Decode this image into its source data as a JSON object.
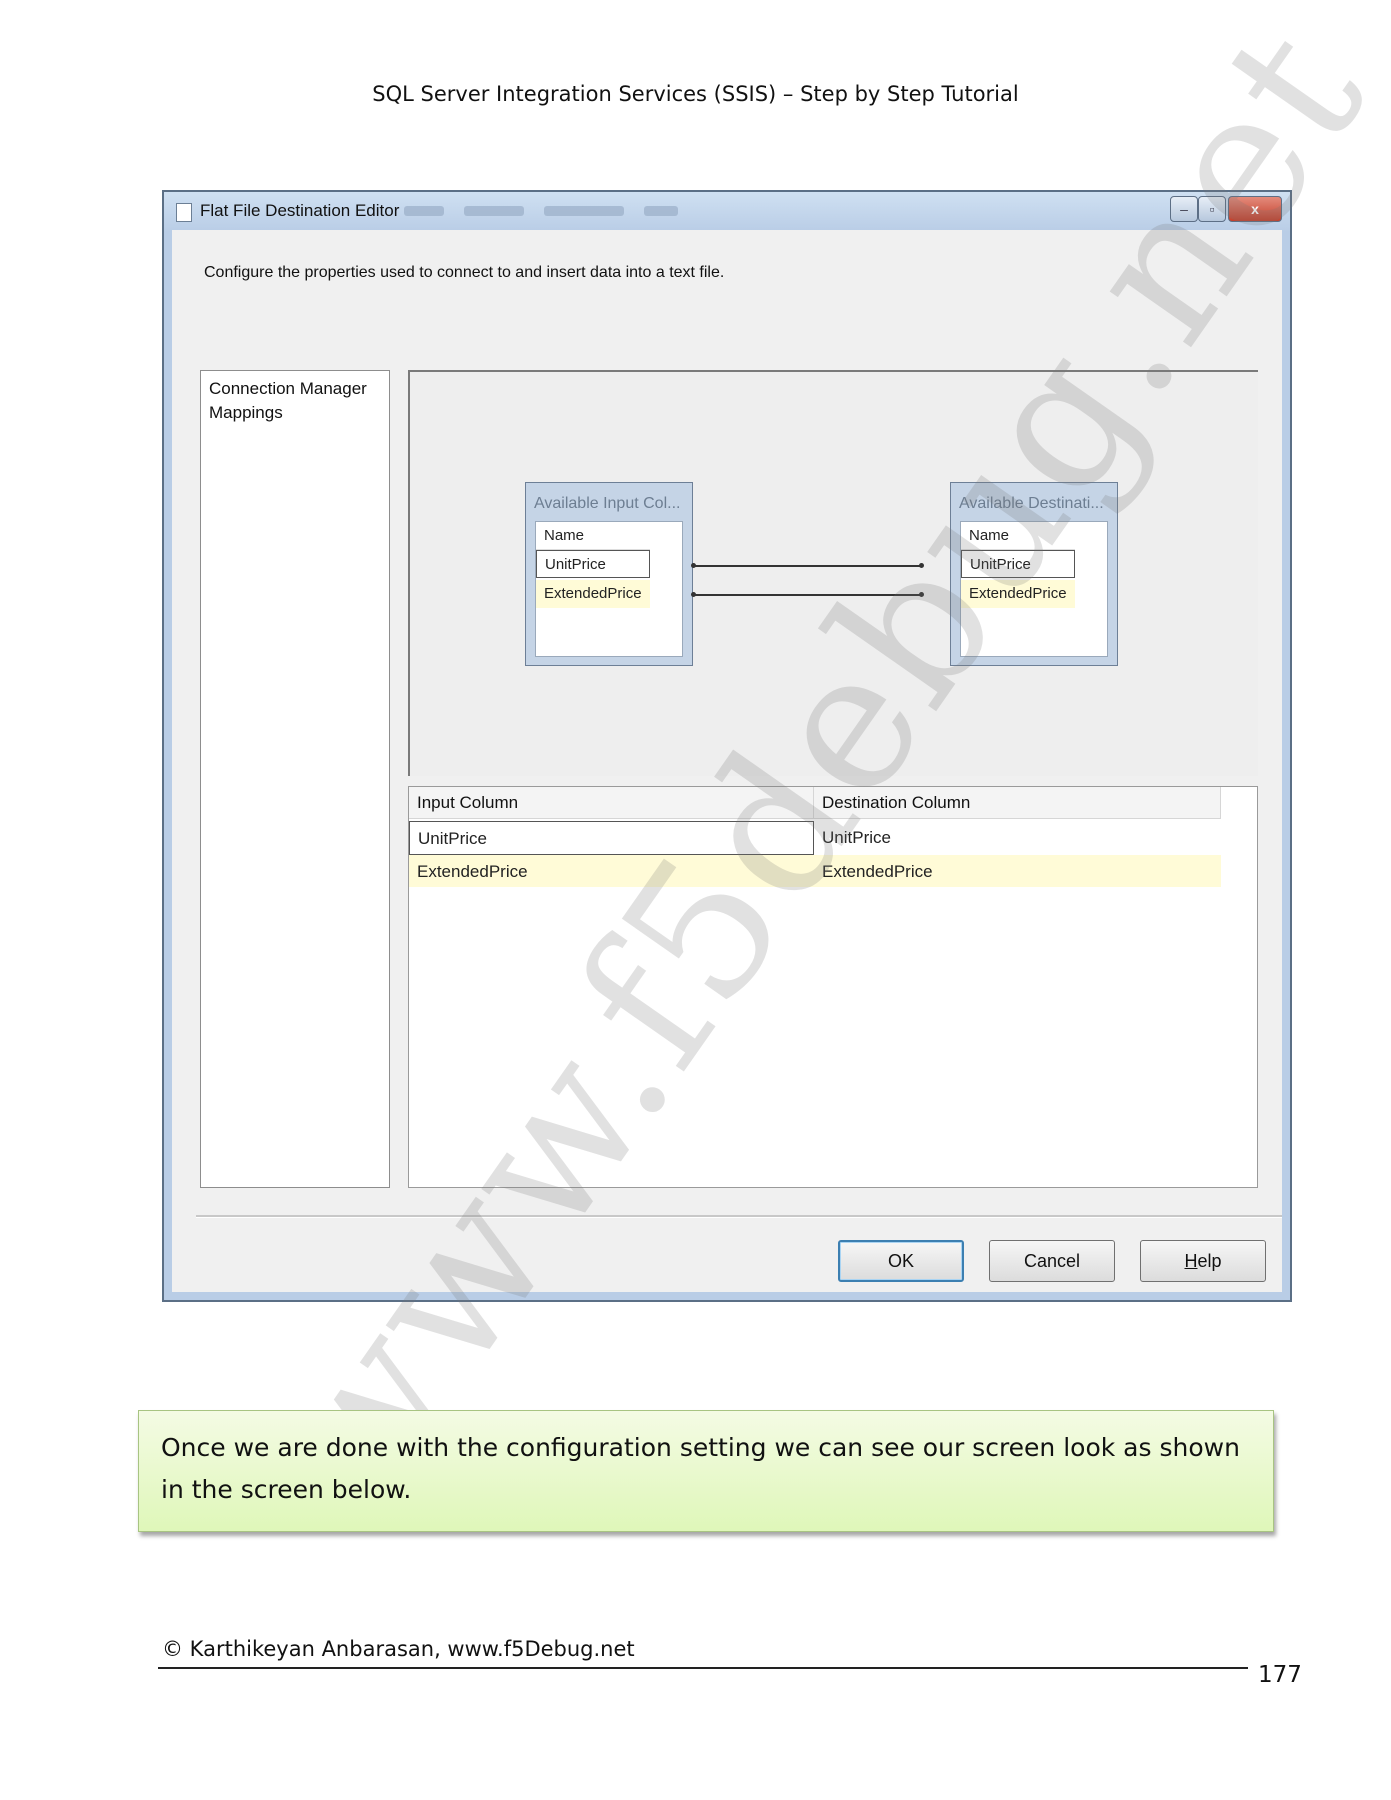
{
  "document": {
    "header": "SQL Server Integration Services (SSIS) – Step by Step Tutorial",
    "note": "Once we are done with the configuration setting we can see our screen look as shown in the screen below.",
    "footer": "© Karthikeyan Anbarasan, www.f5Debug.net",
    "page_number": "177",
    "watermark": "www.f5debug.net"
  },
  "dialog": {
    "title": "Flat File Destination Editor",
    "description": "Configure the properties used to connect to and insert data into a text file.",
    "window_buttons": {
      "minimize": "–",
      "maximize": "▫",
      "close": "x"
    },
    "nav_items": [
      "Connection Manager",
      "Mappings"
    ],
    "input_box": {
      "title": "Available Input Col...",
      "header": "Name",
      "rows": [
        "UnitPrice",
        "ExtendedPrice"
      ]
    },
    "dest_box": {
      "title": "Available Destinati...",
      "header": "Name",
      "rows": [
        "UnitPrice",
        "ExtendedPrice"
      ]
    },
    "grid": {
      "headers": [
        "Input Column",
        "Destination Column"
      ],
      "rows": [
        [
          "UnitPrice",
          "UnitPrice"
        ],
        [
          "ExtendedPrice",
          "ExtendedPrice"
        ]
      ]
    },
    "buttons": {
      "ok": "OK",
      "cancel": "Cancel",
      "help_prefix": "H",
      "help_rest": "elp"
    }
  }
}
